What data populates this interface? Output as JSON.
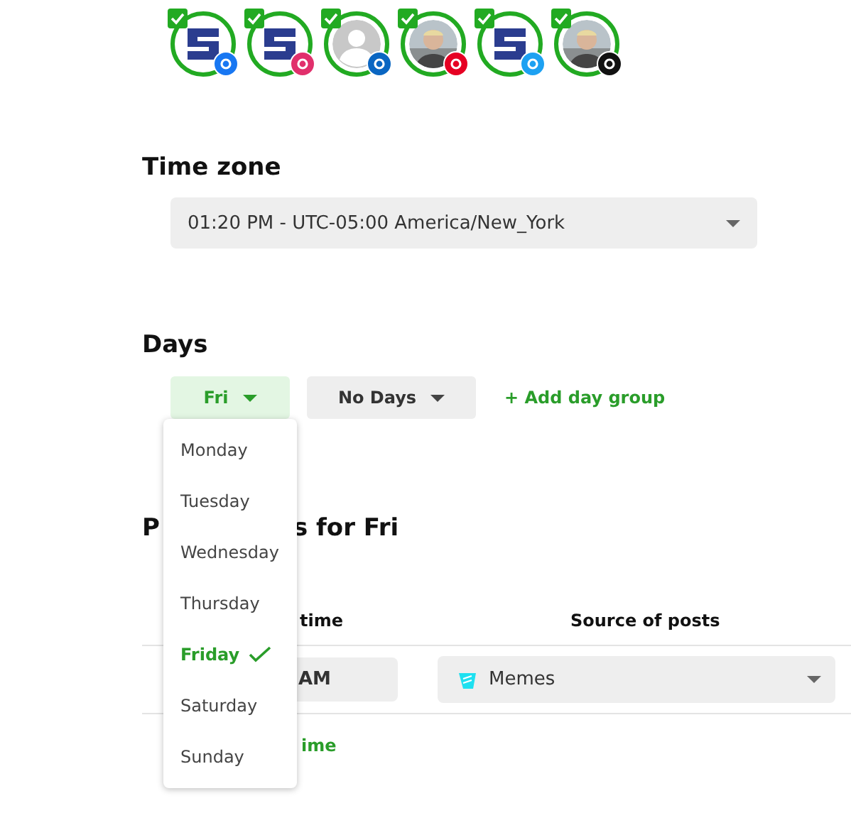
{
  "accounts": [
    {
      "kind": "logo",
      "badge": {
        "kind": "facebook"
      },
      "checked": true
    },
    {
      "kind": "logo",
      "badge": {
        "kind": "instagram"
      },
      "checked": true
    },
    {
      "kind": "placeholder",
      "badge": {
        "kind": "linkedin"
      },
      "checked": true
    },
    {
      "badge": {
        "kind": "pinterest"
      },
      "checked": true
    },
    {
      "kind": "logo",
      "badge": {
        "kind": "twitter"
      },
      "checked": true
    },
    {
      "badge": {
        "kind": "tiktok"
      },
      "checked": true
    }
  ],
  "time_zone": {
    "heading": "Time zone",
    "value": "01:20 PM - UTC-05:00 America/New_York"
  },
  "days": {
    "heading": "Days",
    "groups": [
      {
        "label": "Fri",
        "selected": true
      },
      {
        "label": "No Days",
        "selected": false
      }
    ],
    "add_link": "+ Add day group",
    "menu": [
      {
        "label": "Monday",
        "selected": false
      },
      {
        "label": "Tuesday",
        "selected": false
      },
      {
        "label": "Wednesday",
        "selected": false
      },
      {
        "label": "Thursday",
        "selected": false
      },
      {
        "label": "Friday",
        "selected": true
      },
      {
        "label": "Saturday",
        "selected": false
      },
      {
        "label": "Sunday",
        "selected": false
      }
    ]
  },
  "posting": {
    "heading_start": "P",
    "heading_end": "s for Fri",
    "columns": [
      "time",
      "Source of posts"
    ],
    "rows": [
      {
        "time": "AM",
        "source": "Memes"
      }
    ],
    "add_link": "ime"
  }
}
